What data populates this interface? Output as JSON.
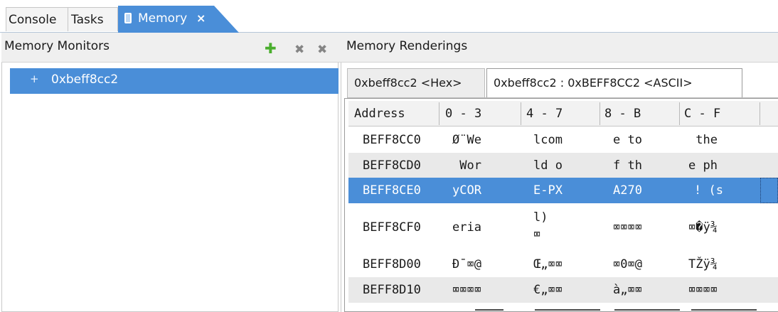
{
  "tabs": [
    {
      "label": "Console"
    },
    {
      "label": "Tasks"
    },
    {
      "label": "Memory",
      "close": "×"
    }
  ],
  "left_panel": {
    "title": "Memory Monitors",
    "toolbar": {
      "add": "✚",
      "remove": "✖",
      "remove_all": "✖"
    },
    "monitors": [
      {
        "marker": "+",
        "address": "0xbeff8cc2"
      }
    ]
  },
  "right_panel": {
    "title": "Memory Renderings",
    "rendering_tabs": [
      {
        "label": "0xbeff8cc2 <Hex>"
      },
      {
        "label": "0xbeff8cc2 : 0xBEFF8CC2 <ASCII>"
      }
    ],
    "table": {
      "columns": [
        "Address",
        "0 - 3",
        "4 - 7",
        "8 - B",
        "C - F"
      ],
      "rows": [
        {
          "address": "BEFF8CC0",
          "c0": "Ø¨We",
          "c1": "lcom",
          "c2": "e to",
          "c3": " the"
        },
        {
          "address": "BEFF8CD0",
          "c0": " Wor",
          "c1": "ld o",
          "c2": "f th",
          "c3": "e ph"
        },
        {
          "address": "BEFF8CE0",
          "c0": "yCOR",
          "c1": "E-PX",
          "c2": "A270",
          "c3": "! (s"
        },
        {
          "address": "BEFF8CF0",
          "c0": "eria",
          "c1": "l)",
          "c1b": "⌧",
          "c2": "⌧⌧⌧⌧",
          "c3": "⌧�ÿ¾"
        },
        {
          "address": "BEFF8D00",
          "c0": "Ð¯⌧@",
          "c1": "Œ„⌧⌧",
          "c2": "⌧0⌧@",
          "c3": "TŽÿ¾"
        },
        {
          "address": "BEFF8D10",
          "c0": "⌧⌧⌧⌧",
          "c1": "€„⌧⌧",
          "c2": "à„⌧⌧",
          "c3": "⌧⌧⌧⌧"
        }
      ]
    }
  },
  "colors": {
    "accent": "#4a8ed8",
    "alt_row": "#e9e9e9",
    "header_bg": "#efefef"
  }
}
